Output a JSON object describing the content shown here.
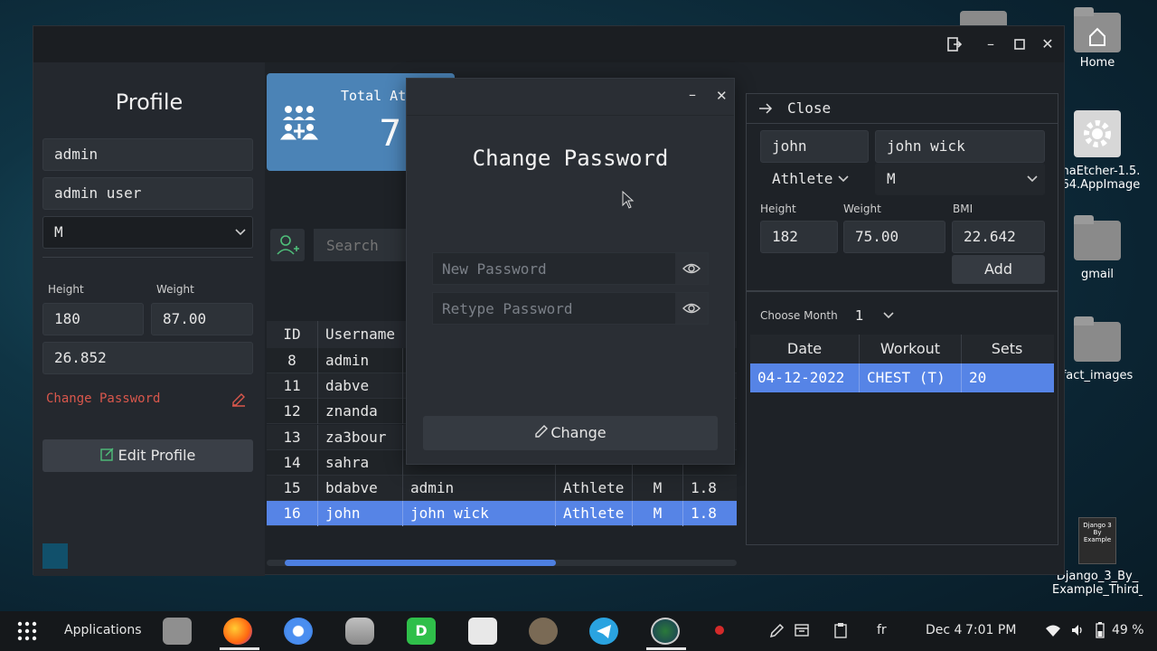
{
  "window": {
    "title_icons": [
      "logout-icon",
      "minimize-icon",
      "maximize-icon",
      "close-icon"
    ]
  },
  "profile": {
    "title": "Profile",
    "username": "admin",
    "full_name": "admin user",
    "gender": "M",
    "height_label": "Height",
    "weight_label": "Weight",
    "height": "180",
    "weight": "87.00",
    "bmi": "26.852",
    "change_password_link": "Change Password",
    "edit_profile_button": "Edit Profile"
  },
  "stats_card": {
    "label": "Total Ath",
    "value": "7"
  },
  "search": {
    "placeholder": "Search"
  },
  "users_table": {
    "columns": [
      "ID",
      "Username",
      "",
      "",
      "",
      ""
    ],
    "rows": [
      {
        "id": "8",
        "username": "admin",
        "name": "",
        "role": "",
        "gender": "",
        "extra": ""
      },
      {
        "id": "11",
        "username": "dabve",
        "name": "",
        "role": "",
        "gender": "",
        "extra": ""
      },
      {
        "id": "12",
        "username": "znanda",
        "name": "",
        "role": "",
        "gender": "",
        "extra": ""
      },
      {
        "id": "13",
        "username": "za3bour",
        "name": "",
        "role": "",
        "gender": "",
        "extra": ""
      },
      {
        "id": "14",
        "username": "sahra",
        "name": "",
        "role": "",
        "gender": "",
        "extra": ""
      },
      {
        "id": "15",
        "username": "bdabve",
        "name": "admin",
        "role": "Athlete",
        "gender": "M",
        "extra": "1.8"
      },
      {
        "id": "16",
        "username": "john",
        "name": "john wick",
        "role": "Athlete",
        "gender": "M",
        "extra": "1.8"
      }
    ],
    "selected_index": 6
  },
  "dialog": {
    "title": "Change Password",
    "new_password_placeholder": "New Password",
    "retype_password_placeholder": "Retype Password",
    "change_button": "Change"
  },
  "athlete_panel": {
    "close_label": "Close",
    "username": "john",
    "full_name": "john wick",
    "role": "Athlete",
    "gender": "M",
    "height_label": "Height",
    "weight_label": "Weight",
    "bmi_label": "BMI",
    "height": "182",
    "weight": "75.00",
    "bmi": "22.642",
    "add_button": "Add",
    "month_label": "Choose Month",
    "month_value": "1",
    "workouts": {
      "columns": [
        "Date",
        "Workout",
        "Sets"
      ],
      "rows": [
        {
          "date": "04-12-2022",
          "workout": "CHEST (T)",
          "sets": "20"
        }
      ]
    }
  },
  "desktop": {
    "icons": [
      "Home",
      "enaEtcher-1.5.",
      "x64.AppImage",
      "gmail",
      "fact_images",
      "Django_3_By_",
      "Example_Third_..."
    ],
    "book_cover_text": "Django 3 By Example"
  },
  "taskbar": {
    "applications_label": "Applications",
    "keyboard_layout": "fr",
    "date": "Dec 4",
    "time": "7:01 PM",
    "battery": "49 %"
  },
  "colors": {
    "accent_blue": "#4b83b6",
    "selection_blue": "#5684e6",
    "danger_red": "#d9574c",
    "green_icon": "#4fbf7a"
  }
}
